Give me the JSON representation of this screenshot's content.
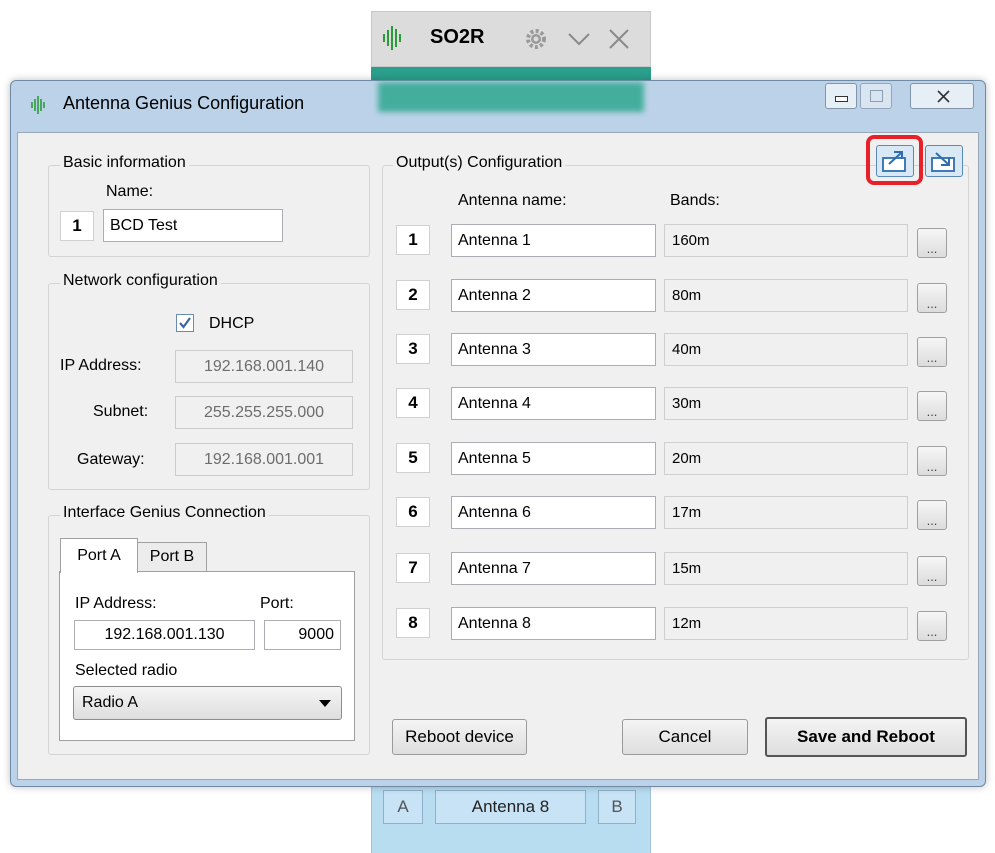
{
  "so2r": {
    "title": "SO2R",
    "slot_a": "A",
    "slot_b": "B",
    "current_antenna": "Antenna 8"
  },
  "dialog": {
    "title": "Antenna Genius Configuration"
  },
  "basic": {
    "legend": "Basic information",
    "name_label": "Name:",
    "index": "1",
    "name_value": "BCD Test"
  },
  "network": {
    "legend": "Network configuration",
    "dhcp_label": "DHCP",
    "dhcp_checked": true,
    "ip_label": "IP Address:",
    "ip_value": "192.168.001.140",
    "subnet_label": "Subnet:",
    "subnet_value": "255.255.255.000",
    "gateway_label": "Gateway:",
    "gateway_value": "192.168.001.001"
  },
  "ig": {
    "legend": "Interface Genius Connection",
    "tab_a": "Port A",
    "tab_b": "Port B",
    "ip_label": "IP Address:",
    "port_label": "Port:",
    "ip_value": "192.168.001.130",
    "port_value": "9000",
    "radio_label": "Selected radio",
    "radio_value": "Radio A"
  },
  "outputs": {
    "legend": "Output(s) Configuration",
    "antenna_header": "Antenna name:",
    "bands_header": "Bands:",
    "more_label": "...",
    "rows": [
      {
        "num": "1",
        "name": "Antenna 1",
        "bands": "160m"
      },
      {
        "num": "2",
        "name": "Antenna 2",
        "bands": "80m"
      },
      {
        "num": "3",
        "name": "Antenna 3",
        "bands": "40m"
      },
      {
        "num": "4",
        "name": "Antenna 4",
        "bands": "30m"
      },
      {
        "num": "5",
        "name": "Antenna 5",
        "bands": "20m"
      },
      {
        "num": "6",
        "name": "Antenna 6",
        "bands": "17m"
      },
      {
        "num": "7",
        "name": "Antenna 7",
        "bands": "15m"
      },
      {
        "num": "8",
        "name": "Antenna 8",
        "bands": "12m"
      }
    ]
  },
  "buttons": {
    "reboot": "Reboot device",
    "cancel": "Cancel",
    "save": "Save and Reboot"
  },
  "icons": {
    "export": "export-icon",
    "import": "import-icon",
    "highlight_color": "#e8202a"
  }
}
